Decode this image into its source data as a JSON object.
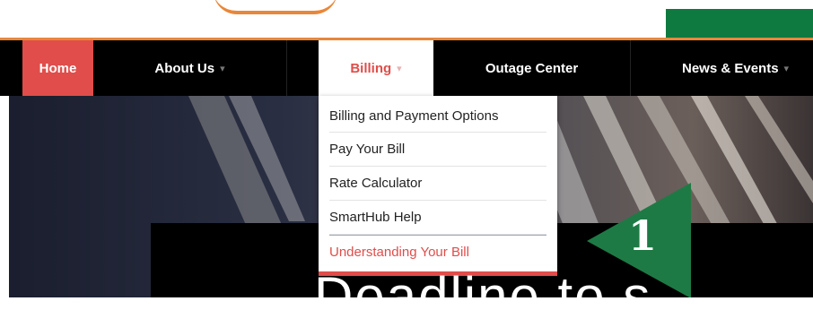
{
  "nav": {
    "home": "Home",
    "about": "About Us",
    "billing": "Billing",
    "outage": "Outage Center",
    "news": "News & Events"
  },
  "billing_menu": {
    "items": [
      "Billing and Payment Options",
      "Pay Your Bill",
      "Rate Calculator",
      "SmartHub Help",
      "Understanding Your Bill"
    ]
  },
  "marker": {
    "number": "1"
  },
  "hero": {
    "headline": "Deadline to s"
  },
  "colors": {
    "accent": "#e04d4a",
    "brand_orange": "#e8873a",
    "brand_green": "#0f7a3f",
    "marker_green": "#1e7a45"
  }
}
